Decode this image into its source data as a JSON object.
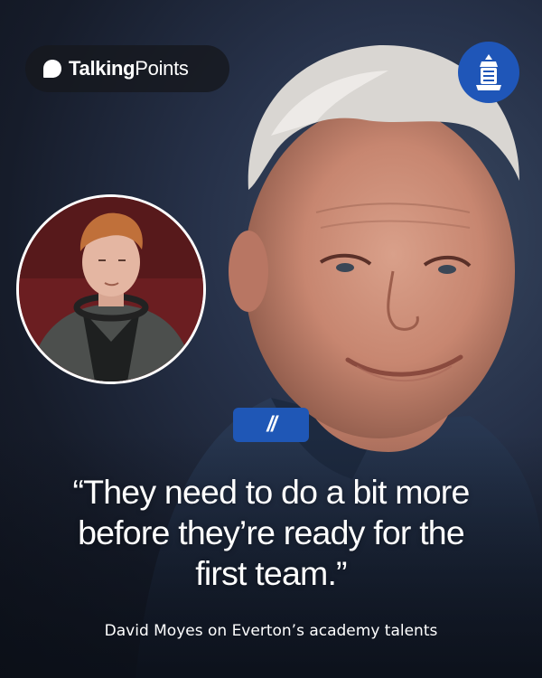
{
  "brand": {
    "name_bold": "Talking",
    "name_regular": "Points",
    "logo_icon": "talkingpoints-logo-icon"
  },
  "crest": {
    "icon": "club-crest-icon",
    "color": "#1f56b8"
  },
  "inset_photo": {
    "subject": "young-player-photo"
  },
  "quote_badge": {
    "label": "//",
    "color": "#1f57b6"
  },
  "quote": {
    "line1": "“They need to do a bit more",
    "line2": "before they’re ready for the",
    "line3": "first team.”"
  },
  "caption": "David Moyes on Everton’s academy talents"
}
